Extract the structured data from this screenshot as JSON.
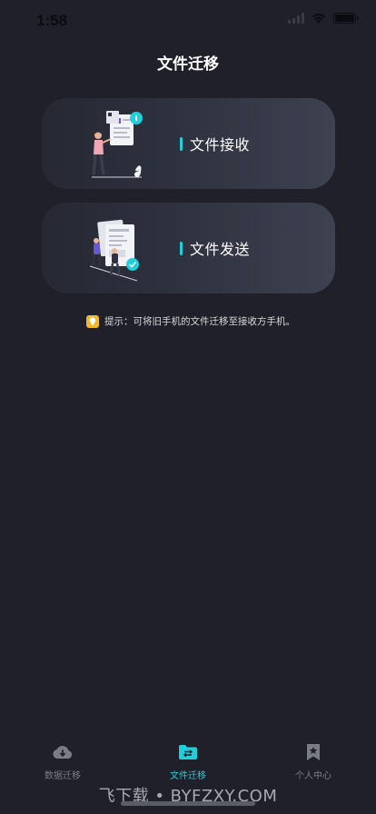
{
  "status_bar": {
    "time": "1:58"
  },
  "header": {
    "title": "文件迁移"
  },
  "cards": [
    {
      "label": "文件接收",
      "illustration": "person-receiving-document-illustration"
    },
    {
      "label": "文件发送",
      "illustration": "people-sending-documents-illustration"
    }
  ],
  "hint": {
    "icon": "lightbulb-icon",
    "text": "提示：可将旧手机的文件迁移至接收方手机。"
  },
  "tabbar": {
    "items": [
      {
        "label": "数据迁移",
        "icon": "cloud-download-icon"
      },
      {
        "label": "文件迁移",
        "icon": "folder-transfer-icon",
        "active": true
      },
      {
        "label": "个人中心",
        "icon": "bookmark-star-icon"
      }
    ]
  },
  "watermark": "飞下载 • BYFZXY.COM",
  "colors": {
    "background": "#1f2029",
    "accent": "#1fd0dc",
    "hint_icon": "#f2b829",
    "inactive_tab": "#7b7d86"
  }
}
